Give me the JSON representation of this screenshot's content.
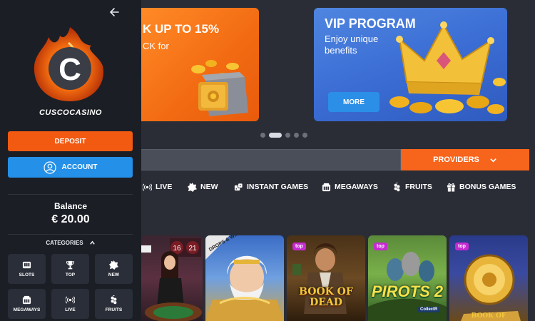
{
  "sidebar": {
    "brand": "CUSCOCASINO",
    "logo_letter": "C",
    "deposit_label": "DEPOSIT",
    "account_label": "ACCOUNT",
    "balance_label": "Balance",
    "balance_value": "€ 20.00",
    "categories_label": "CATEGORIES",
    "tiles": [
      {
        "label": "SLOTS",
        "icon": "slot-machine-icon"
      },
      {
        "label": "TOP",
        "icon": "trophy-icon"
      },
      {
        "label": "NEW",
        "icon": "new-badge-icon"
      },
      {
        "label": "MEGAWAYS",
        "icon": "megaways-icon"
      },
      {
        "label": "LIVE",
        "icon": "live-broadcast-icon"
      },
      {
        "label": "FRUITS",
        "icon": "fruits-icon"
      }
    ]
  },
  "banners": {
    "cashback_title": "K UP TO 15%",
    "cashback_sub": "CK for",
    "vip_title": "VIP PROGRAM",
    "vip_sub": "Enjoy unique benefits",
    "more_label": "MORE"
  },
  "carousel": {
    "count": 5,
    "active": 1
  },
  "providers_label": "PROVIDERS",
  "categories": [
    {
      "label": "LIVE",
      "icon": "live-broadcast-icon"
    },
    {
      "label": "NEW",
      "icon": "new-badge-icon"
    },
    {
      "label": "INSTANT GAMES",
      "icon": "dice-icon"
    },
    {
      "label": "MEGAWAYS",
      "icon": "megaways-icon"
    },
    {
      "label": "FRUITS",
      "icon": "fruits-icon"
    },
    {
      "label": "BONUS GAMES",
      "icon": "gift-icon"
    }
  ],
  "games": [
    {
      "title": "",
      "tag": "",
      "overlay": "16 21"
    },
    {
      "title": "",
      "tag": "DROPS & WINS"
    },
    {
      "title": "BOOK OF DEAD",
      "tag": "top"
    },
    {
      "title": "PIROTS 2",
      "tag": "top",
      "sub": "CollectR"
    },
    {
      "title": "BOOK OF",
      "tag": "top"
    }
  ],
  "colors": {
    "accent_orange": "#f25a12",
    "accent_blue": "#2490e8",
    "sidebar_bg": "#1b1e25",
    "main_bg": "#2a2d36",
    "tag_pink": "#c62bd1"
  }
}
